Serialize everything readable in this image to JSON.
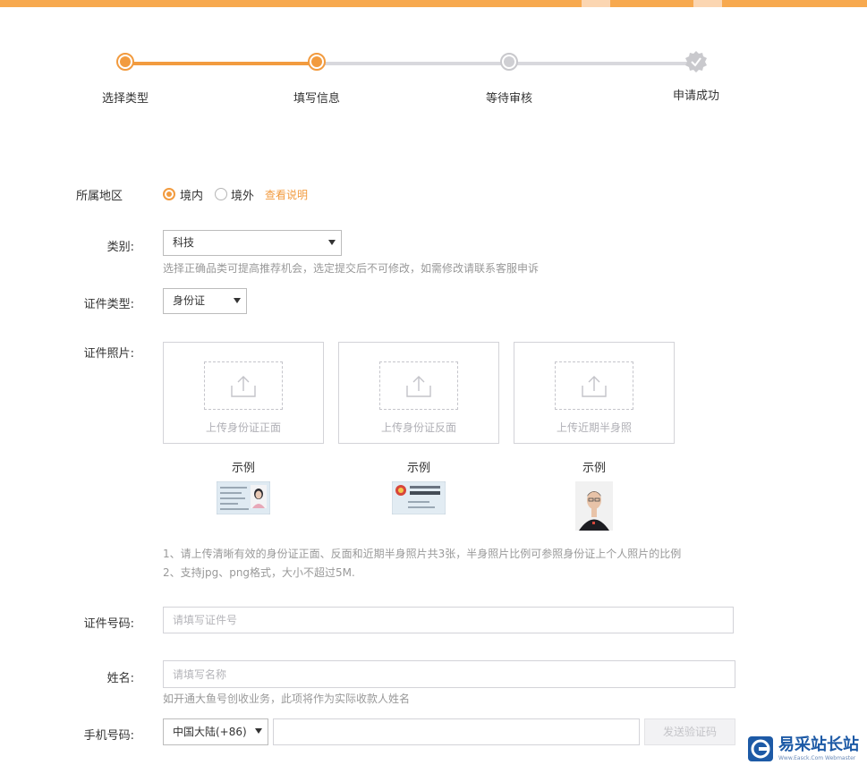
{
  "steps": [
    {
      "label": "选择类型",
      "state": "done"
    },
    {
      "label": "填写信息",
      "state": "done"
    },
    {
      "label": "等待审核",
      "state": "idle"
    },
    {
      "label": "申请成功",
      "state": "idle"
    }
  ],
  "form": {
    "region": {
      "label": "所属地区",
      "options": [
        "境内",
        "境外"
      ],
      "selected": "境内",
      "help_link": "查看说明"
    },
    "category": {
      "label": "类别:",
      "value": "科技",
      "hint": "选择正确品类可提高推荐机会，选定提交后不可修改，如需修改请联系客服申诉"
    },
    "id_type": {
      "label": "证件类型:",
      "value": "身份证"
    },
    "id_photo": {
      "label": "证件照片:",
      "uploads": [
        "上传身份证正面",
        "上传身份证反面",
        "上传近期半身照"
      ],
      "example_label": "示例",
      "notes": [
        "1、请上传清晰有效的身份证正面、反面和近期半身照片共3张，半身照片比例可参照身份证上个人照片的比例",
        "2、支持jpg、png格式，大小不超过5M."
      ]
    },
    "id_number": {
      "label": "证件号码:",
      "placeholder": "请填写证件号"
    },
    "name": {
      "label": "姓名:",
      "placeholder": "请填写名称",
      "hint": "如开通大鱼号创收业务，此项将作为实际收款人姓名"
    },
    "phone": {
      "label": "手机号码:",
      "country": "中国大陆(+86)",
      "send_code": "发送验证码"
    }
  },
  "watermark": {
    "title": "易采站长站",
    "subtitle": "Www.Easck.Com Webmaster"
  },
  "colors": {
    "accent": "#f29b3f",
    "topbar": "#f7a94f",
    "link": "#f29b3f"
  }
}
